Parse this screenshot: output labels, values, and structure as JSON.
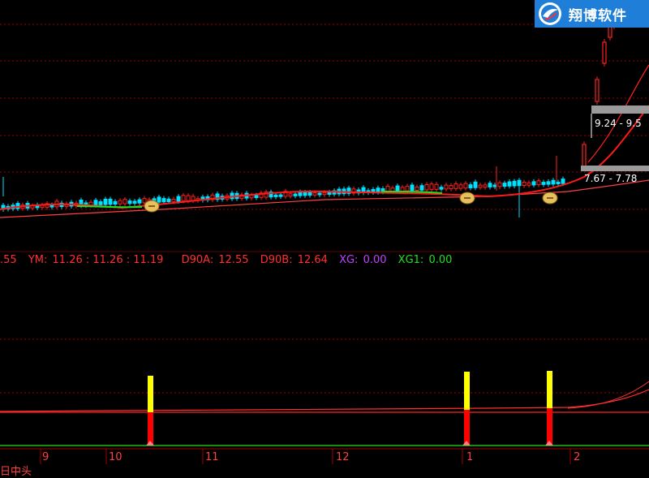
{
  "branding": {
    "logo_text": "翔博软件"
  },
  "indicator_line": {
    "partial_value": ".55",
    "ym_label": "YM:",
    "ym_values": "11.26  : 11.26  : 11.19",
    "d90a_label": "D90A:",
    "d90a_value": "12.55",
    "d90b_label": "D90B:",
    "d90b_value": "12.64",
    "xg_label": "XG:",
    "xg_value": "0.00",
    "xg1_label": "XG1:",
    "xg1_value": "0.00"
  },
  "price_boxes": [
    {
      "text": "9.24 - 9.5"
    },
    {
      "text": "7.67 - 7.78"
    }
  ],
  "x_axis": {
    "months": [
      "9",
      "10",
      "11",
      "12",
      "1",
      "2"
    ]
  },
  "bottom_label": "日中头",
  "colors": {
    "background": "#000000",
    "grid": "#a00000",
    "up": "#ff2020",
    "down": "#00e0ff",
    "ma_red": "#ff1a1a",
    "ma_green": "#20e020",
    "signal_yellow": "#ffff00",
    "signal_red": "#ff0000",
    "logo_bg": "#1f7fd8"
  },
  "icons": {
    "signal_marker": "money-bag-icon",
    "logo": "logo-icon"
  }
}
